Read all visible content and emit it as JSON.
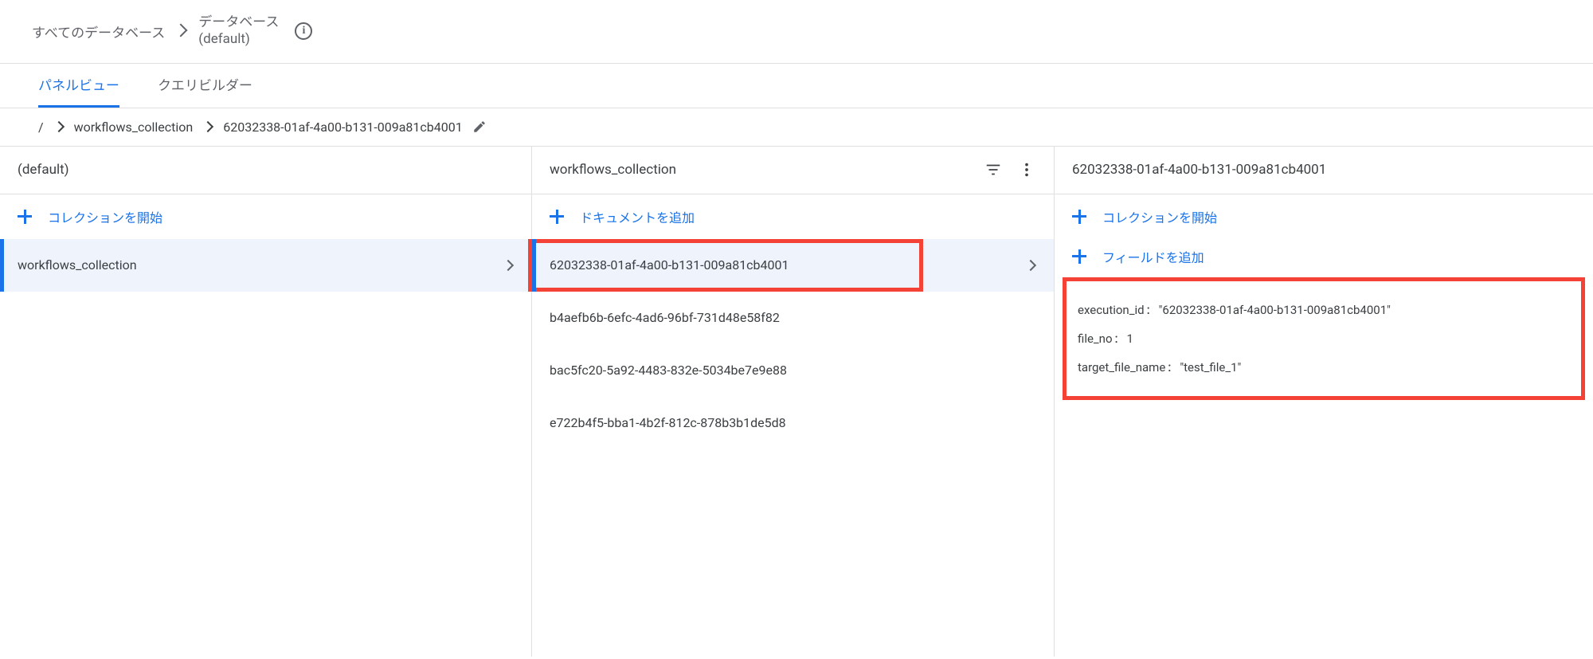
{
  "breadcrumb": {
    "root": "すべてのデータベース",
    "db_label": "データベース",
    "db_name": "(default)"
  },
  "tabs": {
    "panel_view": "パネルビュー",
    "query_builder": "クエリビルダー"
  },
  "path": {
    "root": "/",
    "collection": "workflows_collection",
    "doc_id": "62032338-01af-4a00-b131-009a81cb4001"
  },
  "icon_names": {
    "info": "info-icon",
    "edit": "pencil-icon",
    "filter": "filter-icon",
    "more": "more-vert-icon"
  },
  "panel1": {
    "title": "(default)",
    "action": "コレクションを開始",
    "items": [
      "workflows_collection"
    ],
    "selected_index": 0
  },
  "panel2": {
    "title": "workflows_collection",
    "action": "ドキュメントを追加",
    "items": [
      "62032338-01af-4a00-b131-009a81cb4001",
      "b4aefb6b-6efc-4ad6-96bf-731d48e58f82",
      "bac5fc20-5a92-4483-832e-5034be7e9e88",
      "e722b4f5-bba1-4b2f-812c-878b3b1de5d8"
    ],
    "selected_index": 0
  },
  "panel3": {
    "title": "62032338-01af-4a00-b131-009a81cb4001",
    "action_collection": "コレクションを開始",
    "action_field": "フィールドを追加",
    "fields": [
      {
        "key": "execution_id",
        "value": "62032338-01af-4a00-b131-009a81cb4001",
        "type": "string"
      },
      {
        "key": "file_no",
        "value": "1",
        "type": "number"
      },
      {
        "key": "target_file_name",
        "value": "test_file_1",
        "type": "string"
      }
    ]
  }
}
